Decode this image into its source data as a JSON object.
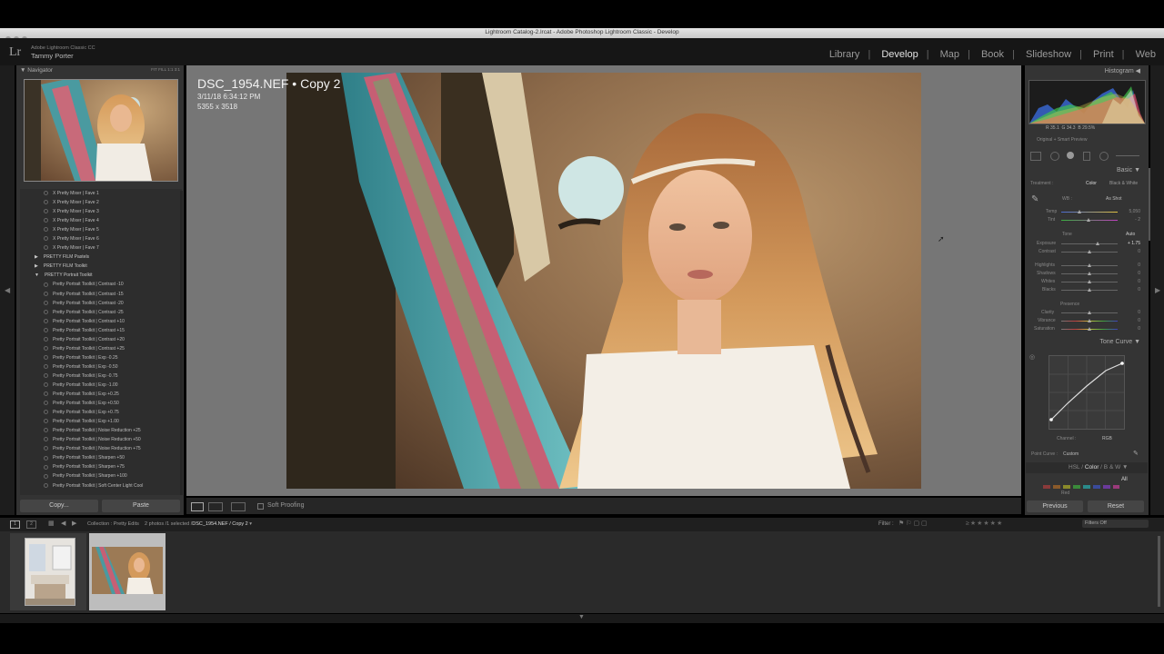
{
  "window": {
    "title": "Lightroom Catalog-2.lrcat - Adobe Photoshop Lightroom Classic - Develop"
  },
  "identity": {
    "logo": "Lr",
    "app_name": "Adobe Lightroom Classic CC",
    "user": "Tammy Porter"
  },
  "modules": [
    {
      "label": "Library",
      "active": false
    },
    {
      "label": "Develop",
      "active": true
    },
    {
      "label": "Map",
      "active": false
    },
    {
      "label": "Book",
      "active": false
    },
    {
      "label": "Slideshow",
      "active": false
    },
    {
      "label": "Print",
      "active": false
    },
    {
      "label": "Web",
      "active": false
    }
  ],
  "navigator": {
    "title": "Navigator",
    "zoom_options": [
      "FIT",
      "FILL",
      "1:1",
      "3:1"
    ]
  },
  "presets": [
    {
      "label": "X Pretty Mixer | Fave 1",
      "folder": false
    },
    {
      "label": "X Pretty Mixer | Fave 2",
      "folder": false
    },
    {
      "label": "X Pretty Mixer | Fave 3",
      "folder": false
    },
    {
      "label": "X Pretty Mixer | Fave 4",
      "folder": false
    },
    {
      "label": "X Pretty Mixer | Fave 5",
      "folder": false
    },
    {
      "label": "X Pretty Mixer | Fave 6",
      "folder": false
    },
    {
      "label": "X Pretty Mixer | Fave 7",
      "folder": false
    },
    {
      "label": "PRETTY FILM Pastels",
      "folder": true,
      "open": false
    },
    {
      "label": "PRETTY FILM Toolkit",
      "folder": true,
      "open": false
    },
    {
      "label": "PRETTY Portrait Toolkit",
      "folder": true,
      "open": true
    },
    {
      "label": "Pretty Portrait Toolkit | Contrast -10",
      "folder": false
    },
    {
      "label": "Pretty Portrait Toolkit | Contrast -15",
      "folder": false
    },
    {
      "label": "Pretty Portrait Toolkit | Contrast -20",
      "folder": false
    },
    {
      "label": "Pretty Portrait Toolkit | Contrast -25",
      "folder": false
    },
    {
      "label": "Pretty Portrait Toolkit | Contrast +10",
      "folder": false
    },
    {
      "label": "Pretty Portrait Toolkit | Contrast +15",
      "folder": false
    },
    {
      "label": "Pretty Portrait Toolkit | Contrast +20",
      "folder": false
    },
    {
      "label": "Pretty Portrait Toolkit | Contrast +25",
      "folder": false
    },
    {
      "label": "Pretty Portrait Toolkit | Exp -0.25",
      "folder": false
    },
    {
      "label": "Pretty Portrait Toolkit | Exp -0.50",
      "folder": false
    },
    {
      "label": "Pretty Portrait Toolkit | Exp -0.75",
      "folder": false
    },
    {
      "label": "Pretty Portrait Toolkit | Exp -1.00",
      "folder": false
    },
    {
      "label": "Pretty Portrait Toolkit | Exp +0.25",
      "folder": false
    },
    {
      "label": "Pretty Portrait Toolkit | Exp +0.50",
      "folder": false
    },
    {
      "label": "Pretty Portrait Toolkit | Exp +0.75",
      "folder": false
    },
    {
      "label": "Pretty Portrait Toolkit | Exp +1.00",
      "folder": false
    },
    {
      "label": "Pretty Portrait Toolkit | Noise Reduction +25",
      "folder": false
    },
    {
      "label": "Pretty Portrait Toolkit | Noise Reduction +50",
      "folder": false
    },
    {
      "label": "Pretty Portrait Toolkit | Noise Reduction +75",
      "folder": false
    },
    {
      "label": "Pretty Portrait Toolkit | Sharpen +50",
      "folder": false
    },
    {
      "label": "Pretty Portrait Toolkit | Sharpen +75",
      "folder": false
    },
    {
      "label": "Pretty Portrait Toolkit | Sharpen +100",
      "folder": false
    },
    {
      "label": "Pretty Portrait Toolkit | Soft Center Light Cool",
      "folder": false
    }
  ],
  "left_buttons": {
    "copy": "Copy...",
    "paste": "Paste"
  },
  "photo": {
    "filename": "DSC_1954.NEF",
    "copy": "Copy 2",
    "date": "3/11/18 6:34:12 PM",
    "dimensions": "5355 x 3518"
  },
  "toolbar": {
    "soft_proofing": "Soft Proofing"
  },
  "right": {
    "histogram": "Histogram",
    "histogram_values": {
      "r_label": "R",
      "r": "35.1",
      "g_label": "G",
      "g": "34.3",
      "b_label": "B",
      "b": "29.5",
      "unit": "%"
    },
    "original_preview": "Original + Smart Preview",
    "basic": "Basic",
    "treatment_label": "Treatment :",
    "treatment_color": "Color",
    "treatment_bw": "Black & White",
    "wb_label": "WB :",
    "wb_value": "As Shot",
    "temp": {
      "label": "Temp",
      "value": "5,050"
    },
    "tint": {
      "label": "Tint",
      "value": "- 2"
    },
    "tone_label": "Tone",
    "auto": "Auto",
    "exposure": {
      "label": "Exposure",
      "value": "+ 1.75"
    },
    "contrast": {
      "label": "Contrast",
      "value": "0"
    },
    "highlights": {
      "label": "Highlights",
      "value": "0"
    },
    "shadows": {
      "label": "Shadows",
      "value": "0"
    },
    "whites": {
      "label": "Whites",
      "value": "0"
    },
    "blacks": {
      "label": "Blacks",
      "value": "0"
    },
    "presence_label": "Presence",
    "clarity": {
      "label": "Clarity",
      "value": "0"
    },
    "vibrance": {
      "label": "Vibrance",
      "value": "0"
    },
    "saturation": {
      "label": "Saturation",
      "value": "0"
    },
    "tone_curve": "Tone Curve",
    "channel_label": "Channel :",
    "channel_value": "RGB",
    "point_curve_label": "Point Curve :",
    "point_curve_value": "Custom",
    "hsl": "HSL",
    "color": "Color",
    "bw": "B & W",
    "all": "All",
    "red": "Red",
    "previous": "Previous",
    "reset": "Reset"
  },
  "filmstrip": {
    "collection": "Collection : Pretty Edits",
    "selection": "2 photos /1 selected /",
    "current": "DSC_1954.NEF / Copy 2",
    "filter_label": "Filter :",
    "filters_off": "Filters Off"
  }
}
